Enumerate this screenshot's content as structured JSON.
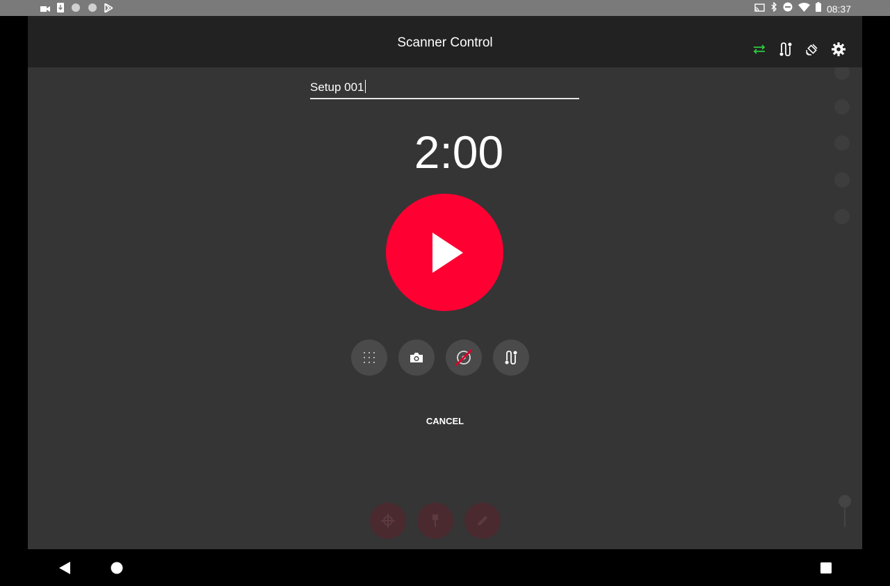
{
  "status_bar": {
    "time": "08:37",
    "left_icons": [
      "video-icon",
      "download-icon",
      "dot-icon",
      "dot-icon",
      "play-store-icon"
    ],
    "right_icons": [
      "cast-icon",
      "bluetooth-icon",
      "do-not-disturb-icon",
      "wifi-icon",
      "battery-icon"
    ]
  },
  "app_bar": {
    "title": "Scanner Control",
    "icons": [
      "sync-icon",
      "route-icon",
      "satellite-icon",
      "settings-icon"
    ],
    "sync_color": "#2ecc40"
  },
  "setup_name": {
    "value": "Setup 001"
  },
  "timer": {
    "display": "2:00"
  },
  "colors": {
    "accent": "#ff0033",
    "background": "#353535",
    "app_bar": "#222222"
  },
  "scan_options": [
    {
      "icon": "grid-icon"
    },
    {
      "icon": "camera-icon"
    },
    {
      "icon": "compass-off-icon"
    },
    {
      "icon": "route-icon"
    }
  ],
  "cancel_label": "CANCEL"
}
